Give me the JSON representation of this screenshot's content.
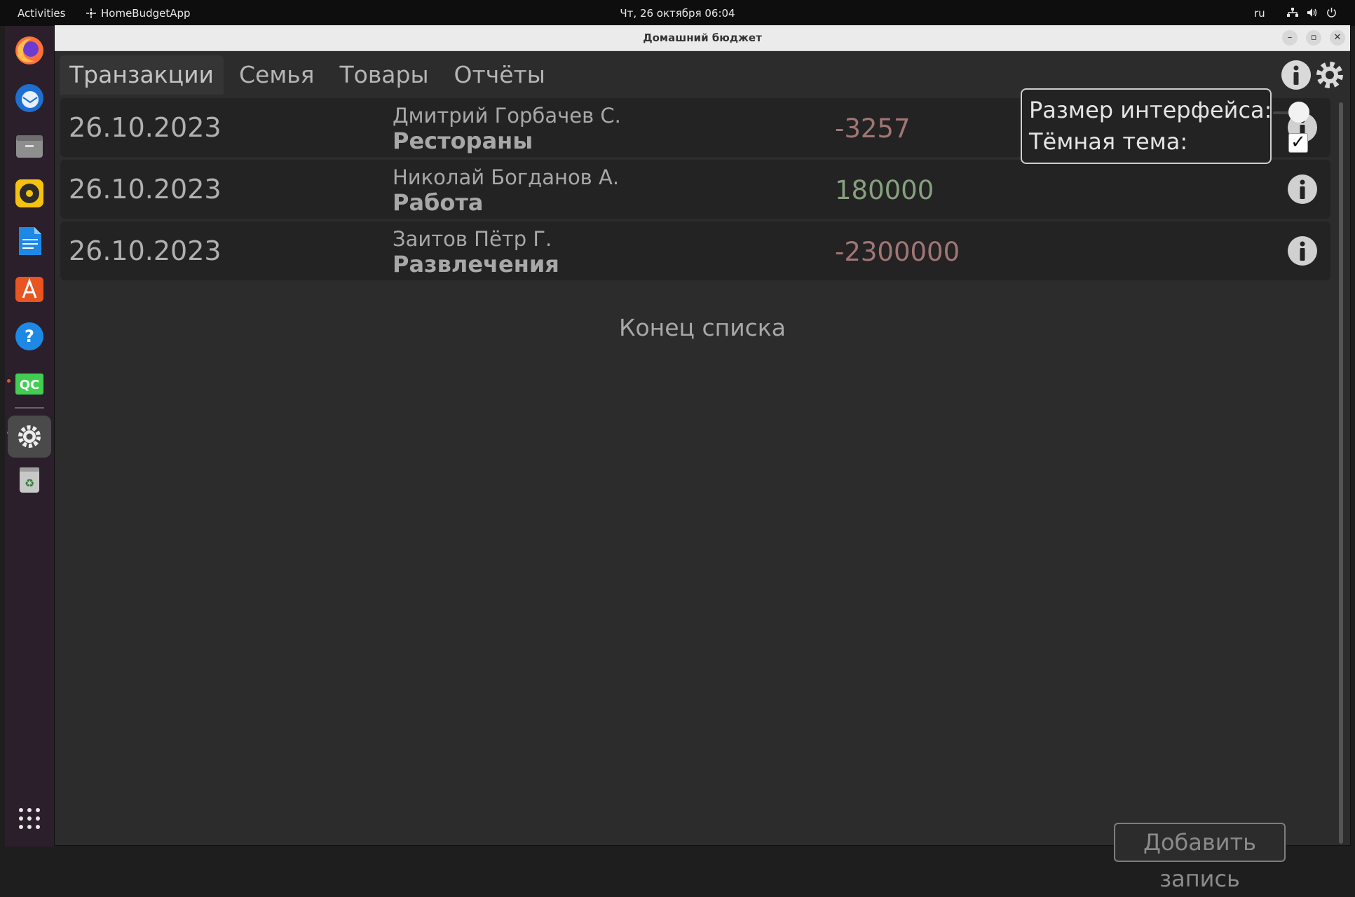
{
  "topbar": {
    "activities": "Activities",
    "app_name": "HomeBudgetApp",
    "clock": "Чт, 26 октября  06:04",
    "lang": "ru"
  },
  "window": {
    "title": "Домашний бюджет"
  },
  "tabs": [
    {
      "label": "Транзакции",
      "active": true
    },
    {
      "label": "Семья",
      "active": false
    },
    {
      "label": "Товары",
      "active": false
    },
    {
      "label": "Отчёты",
      "active": false
    }
  ],
  "transactions": [
    {
      "date": "26.10.2023",
      "person": "Дмитрий Горбачев С.",
      "category": "Рестораны",
      "amount": "-3257",
      "sign": "negative"
    },
    {
      "date": "26.10.2023",
      "person": "Николай Богданов А.",
      "category": "Работа",
      "amount": "180000",
      "sign": "positive"
    },
    {
      "date": "26.10.2023",
      "person": "Заитов Пётр Г.",
      "category": "Развлечения",
      "amount": "-2300000",
      "sign": "negative"
    }
  ],
  "end_of_list": "Конец списка",
  "add_button": "Добавить запись",
  "settings_popup": {
    "size_label": "Размер интерфейса:",
    "theme_label": "Тёмная тема:",
    "dark_theme_checked": true
  },
  "colors": {
    "negative_amount": "#a27575",
    "positive_amount": "#86a07e",
    "accent_dot": "#e95420"
  },
  "dock_icons": [
    "firefox-icon",
    "thunderbird-icon",
    "files-icon",
    "rhythmbox-icon",
    "writer-icon",
    "app-center-icon",
    "help-icon",
    "qt-creator-icon",
    "settings-app-icon",
    "trash-icon",
    "app-grid-icon"
  ]
}
